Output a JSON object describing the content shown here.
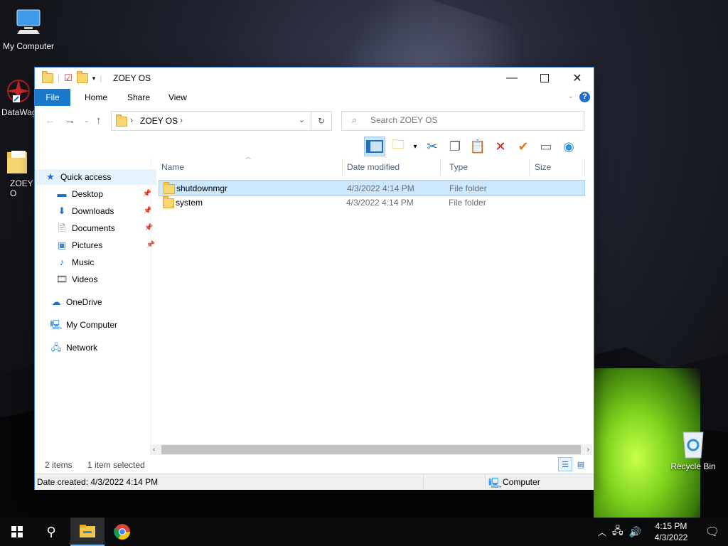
{
  "desktop": {
    "icons": [
      {
        "label": "My Computer"
      },
      {
        "label": "DataWag"
      },
      {
        "label": "ZOEY O"
      },
      {
        "label": "Recycle Bin"
      }
    ]
  },
  "window": {
    "title": "ZOEY OS",
    "ribbon_tabs": [
      "File",
      "Home",
      "Share",
      "View"
    ],
    "address_crumb": "ZOEY OS",
    "search_placeholder": "Search ZOEY OS",
    "nav": {
      "quick_access": "Quick access",
      "items": [
        "Desktop",
        "Downloads",
        "Documents",
        "Pictures",
        "Music",
        "Videos"
      ],
      "onedrive": "OneDrive",
      "my_computer": "My Computer",
      "network": "Network"
    },
    "columns": [
      "Name",
      "Date modified",
      "Type",
      "Size"
    ],
    "files": [
      {
        "name": "shutdownmgr",
        "date": "4/3/2022 4:14 PM",
        "type": "File folder",
        "selected": true
      },
      {
        "name": "system",
        "date": "4/3/2022 4:14 PM",
        "type": "File folder",
        "selected": false
      }
    ],
    "status": {
      "items_count": "2 items",
      "selection": "1 item selected"
    },
    "details": {
      "date_created": "Date created: 4/3/2022 4:14 PM",
      "location": "Computer"
    }
  },
  "taskbar": {
    "time": "4:15 PM",
    "date": "4/3/2022"
  },
  "colors": {
    "accent": "#1979ca",
    "selection": "#cce8ff"
  }
}
